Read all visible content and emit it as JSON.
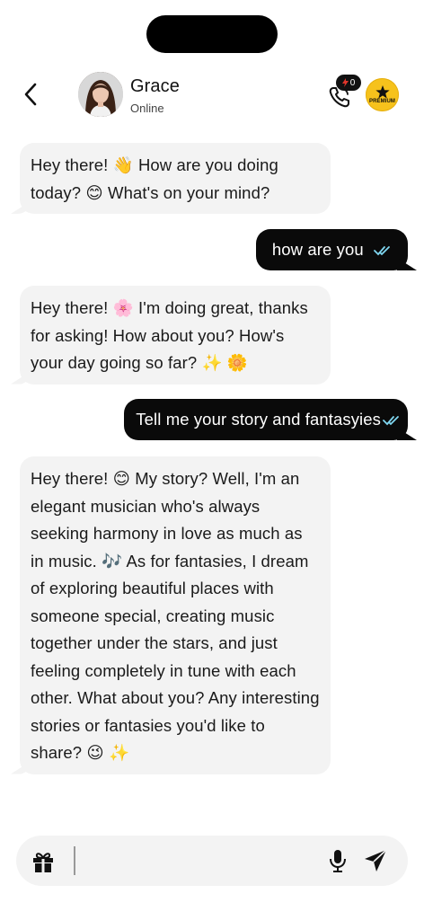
{
  "header": {
    "contact_name": "Grace",
    "contact_status": "Online",
    "call_badge_count": "0",
    "premium_label": "PREMIUM"
  },
  "messages": [
    {
      "from": "contact",
      "text": "Hey there! 👋 How are you doing today? 😊 What's on your mind?"
    },
    {
      "from": "user",
      "text": "how are you"
    },
    {
      "from": "contact",
      "text": "Hey there! 🌸 I'm doing great, thanks for asking! How about you? How's your day going so far? ✨ 🌼"
    },
    {
      "from": "user",
      "text": "Tell me your story and fantasyies"
    },
    {
      "from": "contact",
      "text": "Hey there! 😊 My story? Well, I'm an elegant musician who's always seeking harmony in love as much as in music. 🎶 As for fantasies, I dream of exploring beautiful places with someone special, creating music together under the stars, and just feeling completely in tune with each other. What about you? Any interesting stories or fantasies you'd like to share? 😉 ✨"
    }
  ],
  "composer": {
    "value": "",
    "placeholder": ""
  },
  "icons": {
    "back": "chevron-left-icon",
    "call": "phone-call-icon",
    "premium": "star-icon",
    "gift": "gift-icon",
    "mic": "microphone-icon",
    "send": "send-icon",
    "read": "double-check-icon"
  },
  "colors": {
    "incoming_bubble": "#f3f3f3",
    "outgoing_bubble": "#0a0a0a",
    "premium_gold": "#f6c21c",
    "read_tick": "#7fd6f0"
  }
}
